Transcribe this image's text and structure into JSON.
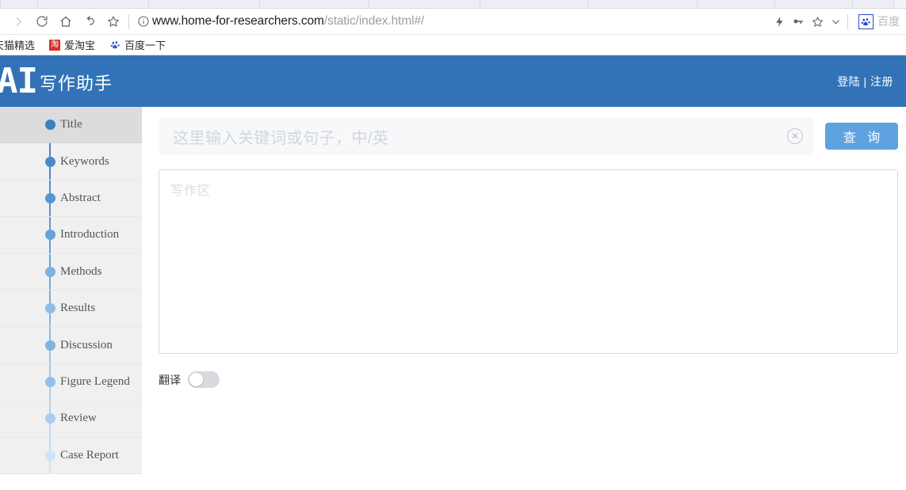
{
  "browser": {
    "toolbar_icons": [
      {
        "name": "forward-icon",
        "glyph": "forward"
      },
      {
        "name": "reload-icon",
        "glyph": "reload"
      },
      {
        "name": "home-icon",
        "glyph": "home"
      },
      {
        "name": "back-icon",
        "glyph": "back"
      },
      {
        "name": "bookmark-star-icon",
        "glyph": "star"
      }
    ],
    "site_info_icon": "info-circle-icon",
    "url": {
      "host": "www.home-for-researchers.com",
      "path": "/static/index.html#/"
    },
    "right_icons": [
      {
        "name": "lightning-icon",
        "glyph": "bolt"
      },
      {
        "name": "key-icon",
        "glyph": "key"
      },
      {
        "name": "star-icon",
        "glyph": "star"
      },
      {
        "name": "chevron-down-icon",
        "glyph": "chevron"
      }
    ],
    "baidu_extension": {
      "icon": "baidu-paw-icon",
      "icon_glyph": "熊",
      "label": "百度"
    },
    "bookmarks": [
      {
        "label": "天猫精选",
        "icon": "none"
      },
      {
        "label": "爱淘宝",
        "icon": "taobao-icon",
        "icon_glyph": "淘"
      },
      {
        "label": "百度一下",
        "icon": "baidu-paw-icon",
        "icon_glyph": "熊"
      }
    ]
  },
  "header": {
    "logo_mark": "AI",
    "logo_text": "写作助手",
    "auth": "登陆 | 注册",
    "background_color": "#3273b8"
  },
  "sidebar": {
    "items": [
      {
        "label": "Title",
        "dot_color": "#3b7fc4",
        "active": true
      },
      {
        "label": "Keywords",
        "dot_color": "#4a89ca",
        "active": false
      },
      {
        "label": "Abstract",
        "dot_color": "#5795d2",
        "active": false
      },
      {
        "label": "Introduction",
        "dot_color": "#66a1d8",
        "active": false
      },
      {
        "label": "Methods",
        "dot_color": "#7fb2e0",
        "active": false
      },
      {
        "label": "Results",
        "dot_color": "#8fbde6",
        "active": false
      },
      {
        "label": "Discussion",
        "dot_color": "#7eb3e2",
        "active": false
      },
      {
        "label": "Figure Legend",
        "dot_color": "#92c0e8",
        "active": false
      },
      {
        "label": "Review",
        "dot_color": "#a8cdee",
        "active": false
      },
      {
        "label": "Case Report",
        "dot_color": "#cfe4f7",
        "active": false
      }
    ]
  },
  "main": {
    "search": {
      "value": "",
      "placeholder": "这里输入关键词或句子，中/英",
      "clear_icon": "clear-circle-icon",
      "button_label": "查 询",
      "button_color": "#5ea2e0"
    },
    "editor": {
      "value": "",
      "placeholder": "写作区"
    },
    "translate": {
      "label": "翻译",
      "enabled": false
    }
  }
}
